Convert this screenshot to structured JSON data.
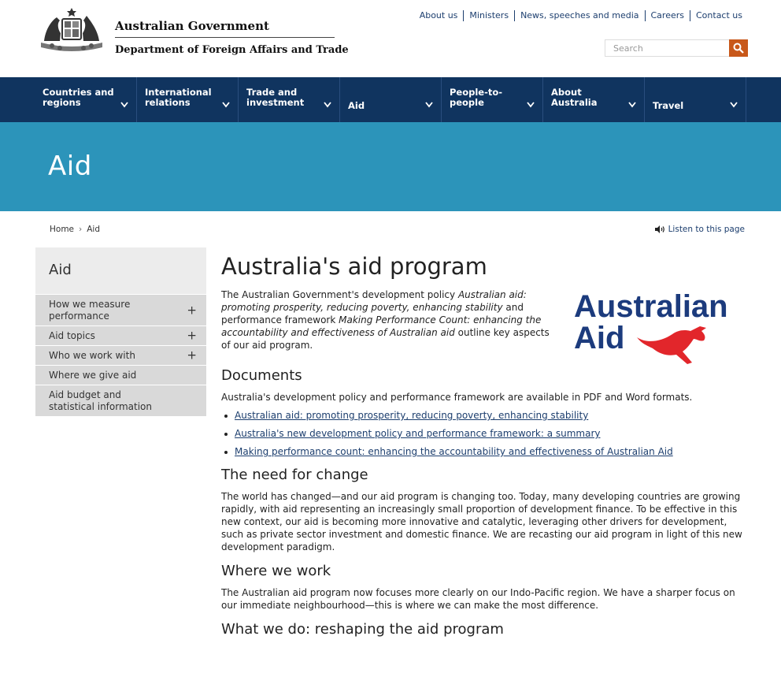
{
  "header": {
    "gov_title": "Australian Government",
    "dept_title": "Department of Foreign Affairs and Trade",
    "top_links": [
      "About us",
      "Ministers",
      "News, speeches and media",
      "Careers",
      "Contact us"
    ],
    "search_placeholder": "Search"
  },
  "nav": [
    {
      "label": "Countries and regions"
    },
    {
      "label": "International relations"
    },
    {
      "label": "Trade and investment"
    },
    {
      "label": "Aid"
    },
    {
      "label": "People-to-people"
    },
    {
      "label": "About Australia"
    },
    {
      "label": "Travel"
    }
  ],
  "banner": {
    "title": "Aid"
  },
  "breadcrumb": {
    "home": "Home",
    "sep": "›",
    "current": "Aid"
  },
  "listen": {
    "label": "Listen to this page"
  },
  "sidebar": {
    "title": "Aid",
    "items": [
      {
        "label": "How we measure performance",
        "plus": "+"
      },
      {
        "label": "Aid topics",
        "plus": "+"
      },
      {
        "label": "Who we work with",
        "plus": "+"
      },
      {
        "label": "Where we give aid",
        "plus": ""
      },
      {
        "label": "Aid budget and statistical information",
        "plus": ""
      }
    ]
  },
  "main": {
    "title": "Australia's aid program",
    "intro": {
      "t1": "The Australian Government's development policy ",
      "i1": "Australian aid: promoting prosperity, reducing poverty, enhancing stability",
      "t2": " and performance framework ",
      "i2": "Making Performance Count: enhancing the accountability and effectiveness of Australian aid",
      "t3": " outline key aspects of our aid program."
    },
    "logo": {
      "line1": "Australian",
      "line2": "Aid"
    },
    "documents": {
      "heading": "Documents",
      "text": "Australia's development policy and performance framework are available in PDF and Word formats.",
      "links": [
        "Australian aid: promoting prosperity, reducing poverty, enhancing stability",
        "Australia's new development policy and performance framework: a summary",
        "Making performance count: enhancing the accountability and effectiveness of Australian Aid"
      ]
    },
    "need": {
      "heading": "The need for change",
      "text": "The world has changed—and our aid program is changing too. Today, many developing countries are growing rapidly, with aid representing an increasingly small proportion of development finance. To be effective in this new context, our aid is becoming more innovative and catalytic, leveraging other drivers for development, such as private sector investment and domestic finance. We are recasting our aid program in light of this new development paradigm."
    },
    "where": {
      "heading": "Where we work",
      "text": "The Australian aid program now focuses more clearly on our Indo-Pacific region. We have a sharper focus on our immediate neighbourhood—this is where we can make the most difference."
    },
    "what": {
      "heading": "What we do: reshaping the aid program"
    }
  },
  "colors": {
    "nav_bg": "#10345f",
    "banner_bg": "#2c94ba",
    "search_btn": "#c8581a",
    "logo_blue": "#1c3b7d",
    "logo_red": "#e2262b"
  }
}
